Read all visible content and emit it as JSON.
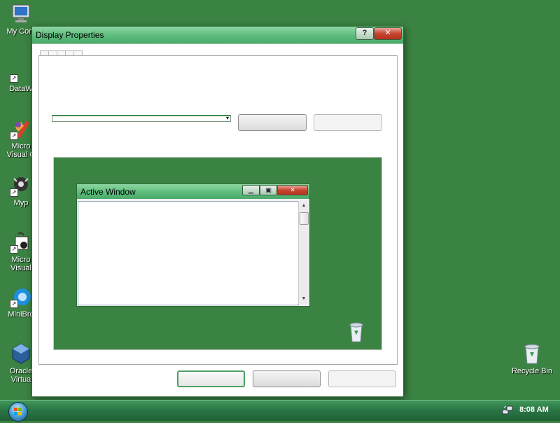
{
  "desktop": {
    "icons": [
      {
        "label": "My Com",
        "icon": "my-computer-icon"
      },
      {
        "label": "DataW",
        "icon": "shortcut-app-icon"
      },
      {
        "label": "Micro",
        "label2": "Visual C",
        "icon": "visual-studio-icon"
      },
      {
        "label": "Myp",
        "icon": "media-app-icon"
      },
      {
        "label": "Micro",
        "label2": "Visual",
        "icon": "visual-studio-icon"
      },
      {
        "label": "MiniBro",
        "icon": "browser-icon"
      },
      {
        "label": "Oracle",
        "label2": "Virtua",
        "icon": "virtualbox-icon"
      },
      {
        "label": "Recycle Bin",
        "icon": "recycle-bin-icon"
      }
    ]
  },
  "dialog": {
    "title": "Display Properties",
    "help_glyph": "?",
    "close_glyph": "✕",
    "combo_arrow": "▾",
    "preview": {
      "window_title": "Active Window",
      "min_glyph": "▁",
      "max_glyph": "▣",
      "close_glyph": "✕",
      "scroll_up": "▲",
      "scroll_down": "▼"
    }
  },
  "taskbar": {
    "clock": "8:08 AM"
  },
  "colors": {
    "desktop": "#3b8343",
    "titlebar": "#5cbd7c",
    "close": "#c8442f"
  }
}
